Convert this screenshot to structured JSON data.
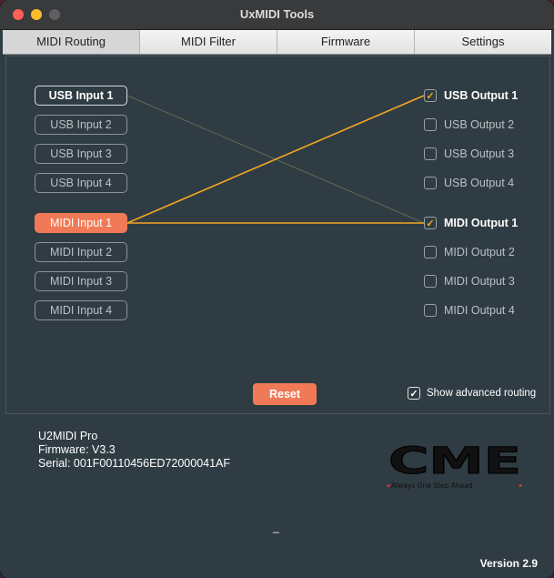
{
  "window": {
    "title": "UxMIDI Tools"
  },
  "tabs": [
    {
      "label": "MIDI Routing",
      "active": true
    },
    {
      "label": "MIDI Filter",
      "active": false
    },
    {
      "label": "Firmware",
      "active": false
    },
    {
      "label": "Settings",
      "active": false
    }
  ],
  "inputs": [
    "USB Input 1",
    "USB Input 2",
    "USB Input 3",
    "USB Input 4",
    "MIDI Input 1",
    "MIDI Input 2",
    "MIDI Input 3",
    "MIDI Input 4"
  ],
  "outputs": [
    {
      "label": "USB Output 1",
      "checked": true
    },
    {
      "label": "USB Output 2",
      "checked": false
    },
    {
      "label": "USB Output 3",
      "checked": false
    },
    {
      "label": "USB Output 4",
      "checked": false
    },
    {
      "label": "MIDI Output 1",
      "checked": true
    },
    {
      "label": "MIDI Output 2",
      "checked": false
    },
    {
      "label": "MIDI Output 3",
      "checked": false
    },
    {
      "label": "MIDI Output 4",
      "checked": false
    }
  ],
  "routes_selected_input": "MIDI Input 1",
  "reset_label": "Reset",
  "advanced": {
    "label": "Show advanced  routing",
    "checked": true
  },
  "device": {
    "name": "U2MIDI Pro",
    "firmware": "Firmware: V3.3",
    "serial": "Serial: 001F00110456ED72000041AF"
  },
  "logo": {
    "brand": "CME",
    "tagline": "Always  One  Step  Ahead"
  },
  "status_dash": "_",
  "version": "Version 2.9",
  "colors": {
    "accent": "#f07a57",
    "route_line": "#f5a623",
    "background": "#2f3c43"
  }
}
